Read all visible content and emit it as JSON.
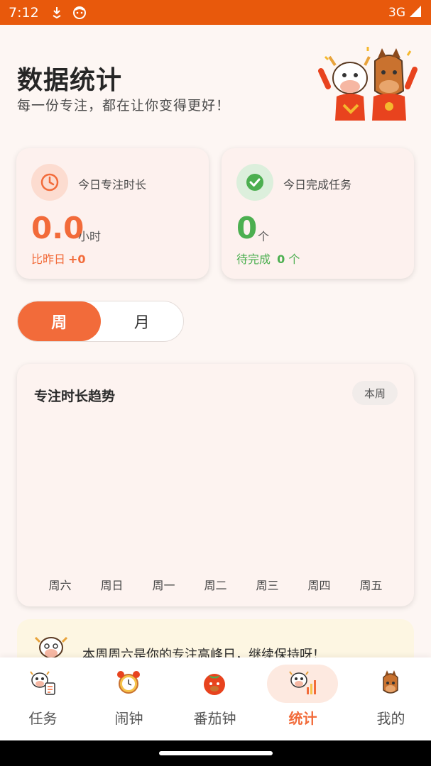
{
  "status_bar": {
    "time": "7:12",
    "network": "3G"
  },
  "header": {
    "title": "数据统计",
    "subtitle": "每一份专注，都在让你变得更好！"
  },
  "stats": {
    "focus": {
      "label": "今日专注时长",
      "value": "0.0",
      "unit": "小时",
      "compare_label": "比昨日",
      "compare_value": "+0",
      "icon": "clock-icon"
    },
    "tasks": {
      "label": "今日完成任务",
      "value": "0",
      "unit": "个",
      "pending_label": "待完成",
      "pending_value": "0",
      "pending_unit": "个",
      "icon": "check-icon"
    }
  },
  "period_toggle": {
    "options": [
      "周",
      "月"
    ],
    "selected": "周"
  },
  "chart_card": {
    "title": "专注时长趋势",
    "badge": "本周"
  },
  "chart_data": {
    "type": "bar",
    "categories": [
      "周六",
      "周日",
      "周一",
      "周二",
      "周三",
      "周四",
      "周五"
    ],
    "values": [
      0,
      0,
      0,
      0,
      0,
      0,
      0
    ],
    "title": "专注时长趋势",
    "grid": false
  },
  "tip": {
    "text": "本周周六是你的专注高峰日，继续保持呀！"
  },
  "bottom_nav": {
    "items": [
      {
        "label": "任务",
        "icon": "cow-task-icon"
      },
      {
        "label": "闹钟",
        "icon": "alarm-clock-icon"
      },
      {
        "label": "番茄钟",
        "icon": "tomato-icon"
      },
      {
        "label": "统计",
        "icon": "cow-chart-icon"
      },
      {
        "label": "我的",
        "icon": "horse-icon"
      }
    ],
    "active": "统计"
  },
  "colors": {
    "accent": "#f26b3a",
    "success": "#4caf50",
    "status_bar": "#e8590c"
  }
}
